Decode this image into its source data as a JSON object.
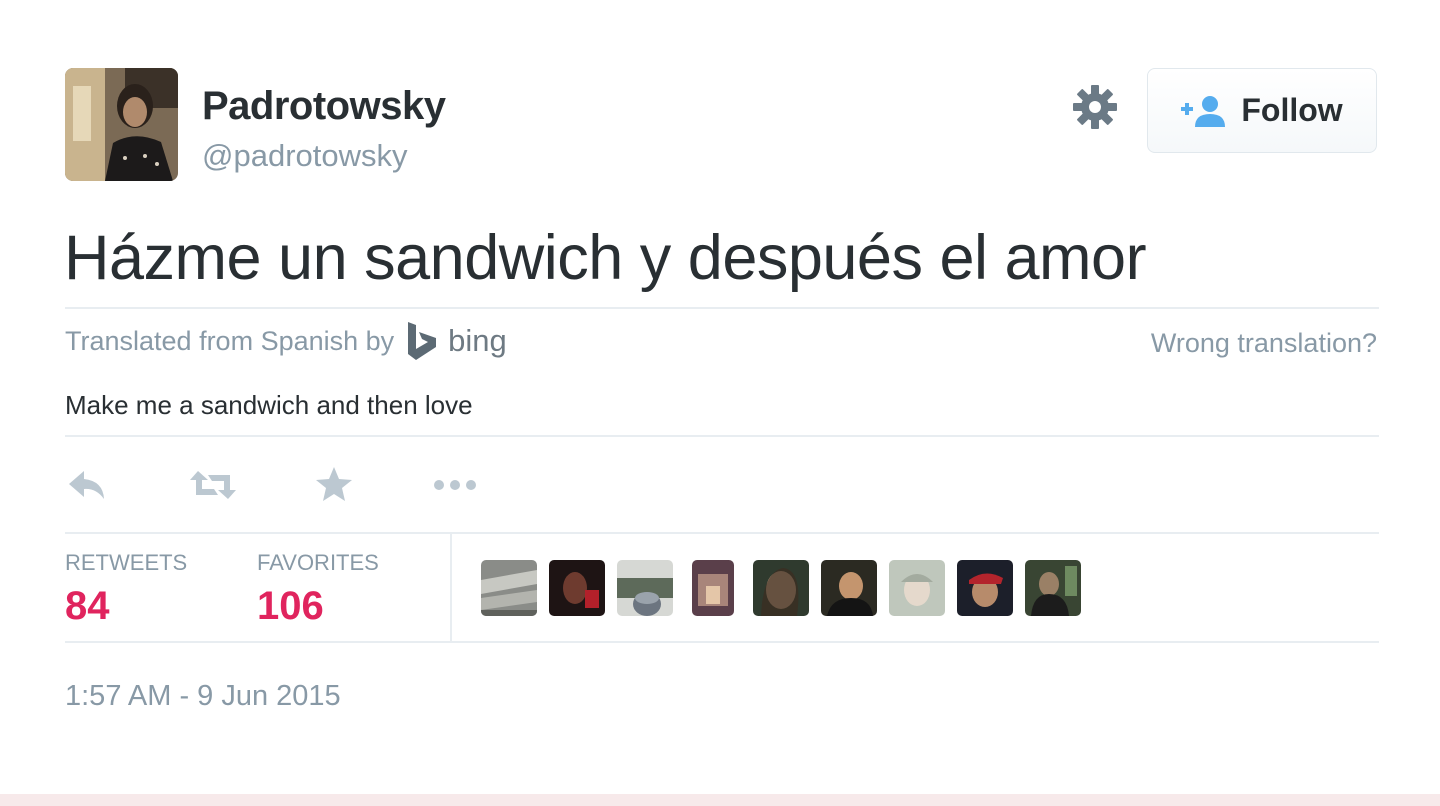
{
  "user": {
    "display_name": "Padrotowsky",
    "screen_name": "@padrotowsky"
  },
  "follow_button": {
    "label": "Follow",
    "icon": "add-user-icon"
  },
  "settings": {
    "icon": "gear-icon"
  },
  "tweet": {
    "text": "Házme un sandwich y después el amor",
    "translated_from": "Translated from Spanish by",
    "translator": "bing",
    "wrong_translation": "Wrong translation?",
    "translation": "Make me a sandwich and then love",
    "timestamp": "1:57 AM - 9 Jun 2015"
  },
  "actions": [
    "reply-icon",
    "retweet-icon",
    "favorite-star-icon",
    "more-dots-icon"
  ],
  "stats": {
    "retweets_label": "RETWEETS",
    "retweets": "84",
    "favorites_label": "FAVORITES",
    "favorites": "106"
  },
  "colors": {
    "text": "#292f33",
    "muted": "#8899a6",
    "count": "#e0245e",
    "follow_icon": "#55acee"
  }
}
